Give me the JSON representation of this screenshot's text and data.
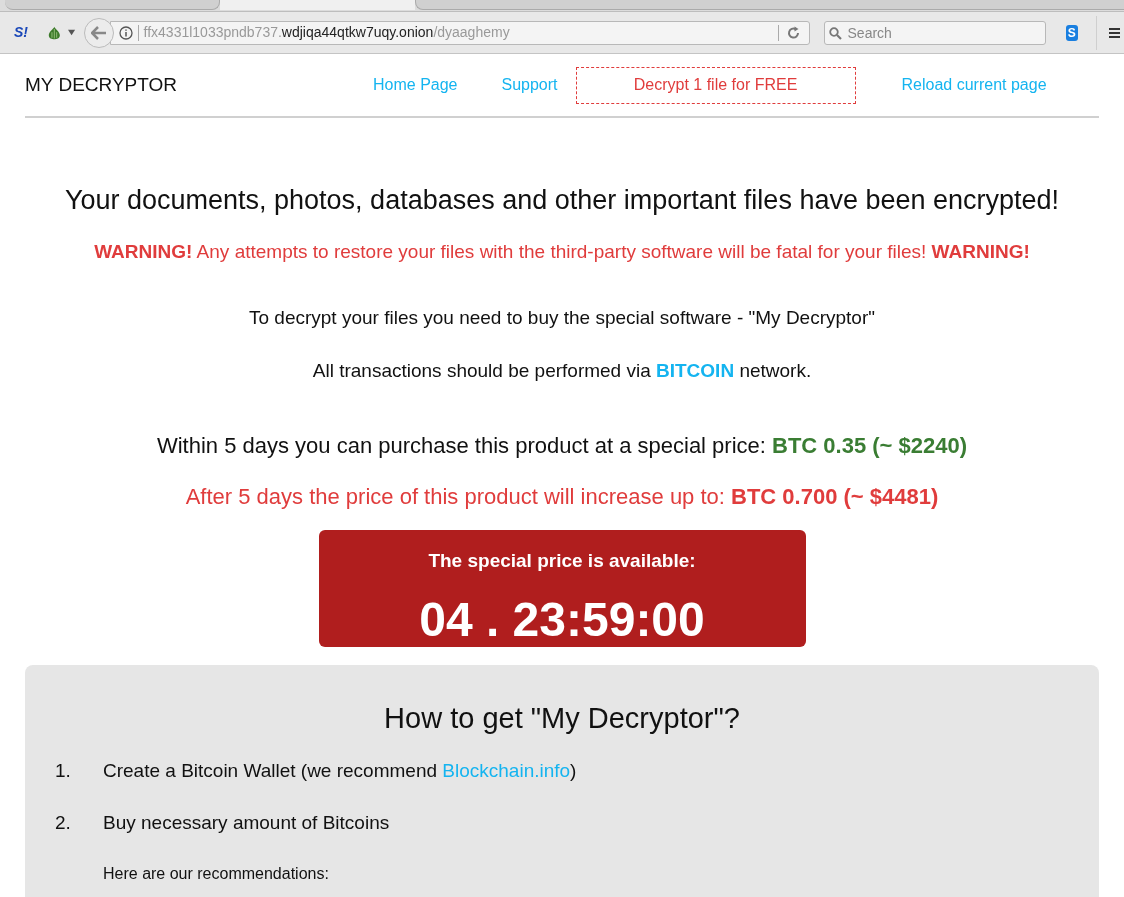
{
  "browser": {
    "addon_icon": "S!",
    "url": {
      "prefix": "ffx4331l1033pndb737.",
      "domain": "wdjiqa44qtkw7uqy.onion",
      "path": "/dyaaghemy"
    },
    "search": {
      "placeholder": "Search"
    },
    "extension_icon": "S"
  },
  "header": {
    "logo": "MY DECRYPTOR",
    "nav": [
      {
        "label": "Home Page",
        "kind": "link"
      },
      {
        "label": "Support",
        "kind": "link"
      },
      {
        "label": "Decrypt 1 file for FREE",
        "kind": "outlined"
      },
      {
        "label": "Reload current page",
        "kind": "link"
      }
    ]
  },
  "headline": "Your documents, photos, databases and other important files have been encrypted!",
  "warning": "**WARNING!** Any attempts to restore your files with the third-party software will be fatal for your files! **WARNING!**",
  "info": [
    {
      "before": "To decrypt your files you need to buy the special software - \"My Decryptor\""
    },
    {
      "before": "All transactions should be performed via ",
      "highlight": "BITCOIN",
      "after": " network."
    }
  ],
  "prices": [
    {
      "text": "Within 5 days you can purchase this product at a special price: ",
      "amount": "BTC 0.35 (~ $2240)",
      "kind": "special"
    },
    {
      "text": "After 5 days the price of this product will increase up to: ",
      "amount": "BTC 0.700 (~ $4481)",
      "kind": "increased"
    }
  ],
  "timer": {
    "title": "The special price is available:",
    "value": "04 . 23:59:00"
  },
  "instructions": {
    "title": "How to get \"My Decryptor\"?",
    "steps": [
      {
        "number": "1.",
        "text": "Create a Bitcoin Wallet (we recommend ",
        "link": "Blockchain.info",
        "after": ")"
      },
      {
        "number": "2.",
        "text": "Buy necessary amount of Bitcoins"
      }
    ],
    "note": "Here are our recommendations:"
  }
}
